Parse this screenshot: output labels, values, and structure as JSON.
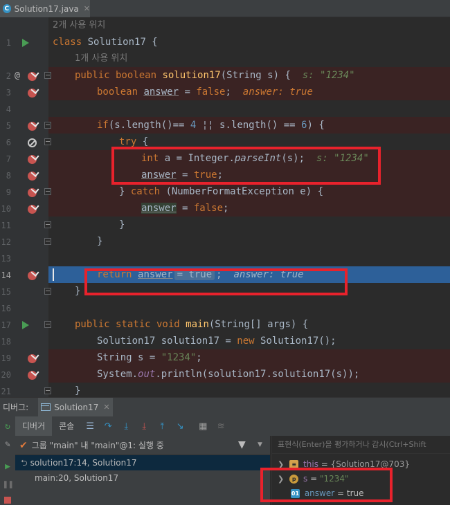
{
  "tab": {
    "filename": "Solution17.java"
  },
  "editor": {
    "usage_hint_class": "2개 사용 위치",
    "usage_hint_method": "1개 사용 위치",
    "line_numbers": [
      "1",
      "2",
      "3",
      "4",
      "5",
      "6",
      "7",
      "8",
      "9",
      "10",
      "11",
      "12",
      "13",
      "14",
      "15",
      "16",
      "17",
      "18",
      "19",
      "20",
      "21"
    ],
    "inline_hints": {
      "s_param": "s: \"1234\"",
      "answer_line3": "answer: true",
      "parse_line7": "s: \"1234\"",
      "return_inline": "= true",
      "return_hint": "answer: true"
    }
  },
  "debugger": {
    "label": "디버그:",
    "session_tab": "Solution17",
    "tabs": [
      "디버거",
      "콘솔"
    ],
    "thread_status": "그룹 \"main\" 내 \"main\"@1: 실행 중",
    "frames": [
      "solution17:14, Solution17",
      "main:20, Solution17"
    ],
    "expression_placeholder": "표현식(Enter)을 평가하거나 감시(Ctrl+Shift",
    "variables": [
      {
        "name": "this",
        "value": "{Solution17@703}"
      },
      {
        "name": "s",
        "value": "\"1234\""
      },
      {
        "name": "answer",
        "value": "true"
      }
    ]
  },
  "colors": {
    "background": "#2b2b2b",
    "breakpoint": "#c75450",
    "current_line": "#2d6099",
    "annotation_box": "#e8222c"
  }
}
